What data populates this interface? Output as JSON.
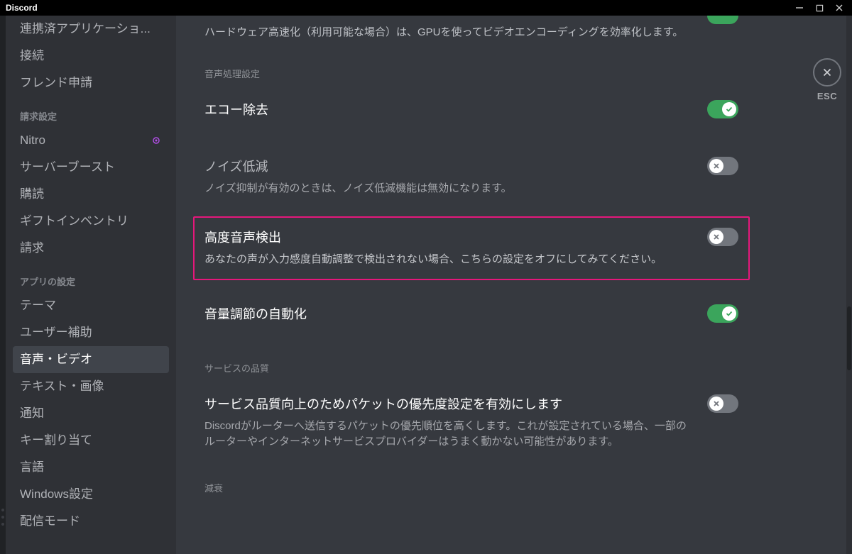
{
  "window": {
    "title": "Discord",
    "esc_label": "ESC"
  },
  "sidebar": {
    "items_top": [
      "連携済アプリケーショ...",
      "接続",
      "フレンド申請"
    ],
    "section_billing": "請求設定",
    "items_billing": [
      "Nitro",
      "サーバーブースト",
      "購読",
      "ギフトインベントリ",
      "請求"
    ],
    "section_app": "アプリの設定",
    "items_app": [
      "テーマ",
      "ユーザー補助",
      "音声・ビデオ",
      "テキスト・画像",
      "通知",
      "キー割り当て",
      "言語",
      "Windows設定",
      "配信モード"
    ],
    "active_index": 2
  },
  "main": {
    "top_desc": "ハードウェア高速化（利用可能な場合）は、GPUを使ってビデオエンコーディングを効率化します。",
    "section_audio": "音声処理設定",
    "settings": {
      "echo": {
        "title": "エコー除去",
        "on": true
      },
      "noise": {
        "title": "ノイズ低減",
        "desc": "ノイズ抑制が有効のときは、ノイズ低減機能は無効になります。",
        "on": false
      },
      "advdetect": {
        "title": "高度音声検出",
        "desc": "あなたの声が入力感度自動調整で検出されない場合、こちらの設定をオフにしてみてください。",
        "on": false
      },
      "autovol": {
        "title": "音量調節の自動化",
        "on": true
      }
    },
    "section_qos": "サービスの品質",
    "qos": {
      "title": "サービス品質向上のためパケットの優先度設定を有効にします",
      "desc": "Discordがルーターへ送信するパケットの優先順位を高くします。これが設定されている場合、一部のルーターやインターネットサービスプロバイダーはうまく動かない可能性があります。",
      "on": false
    },
    "section_atten": "減衰"
  }
}
